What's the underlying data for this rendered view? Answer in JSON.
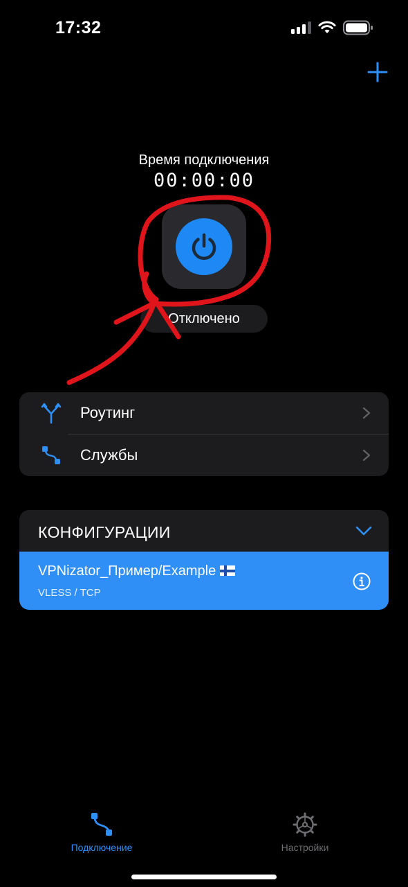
{
  "status_bar": {
    "time": "17:32"
  },
  "header": {
    "add_icon": "plus-icon"
  },
  "connection": {
    "title": "Время подключения",
    "timer": "00:00:00",
    "power_icon": "power-icon",
    "status": "Отключено"
  },
  "menu": {
    "items": [
      {
        "label": "Роутинг",
        "icon": "routing-icon"
      },
      {
        "label": "Службы",
        "icon": "services-icon"
      }
    ]
  },
  "configs": {
    "title": "КОНФИГУРАЦИИ",
    "items": [
      {
        "name": "VPNizator_Пример/Example",
        "flag": "finland-flag",
        "protocol": "VLESS / TCP"
      }
    ]
  },
  "tabbar": {
    "items": [
      {
        "label": "Подключение",
        "active": true,
        "icon": "connection-icon"
      },
      {
        "label": "Настройки",
        "active": false,
        "icon": "gear-icon"
      }
    ]
  },
  "colors": {
    "accent": "#2f8ff6",
    "background": "#000000",
    "card": "#1c1c1e",
    "annotation": "#e0141b"
  }
}
